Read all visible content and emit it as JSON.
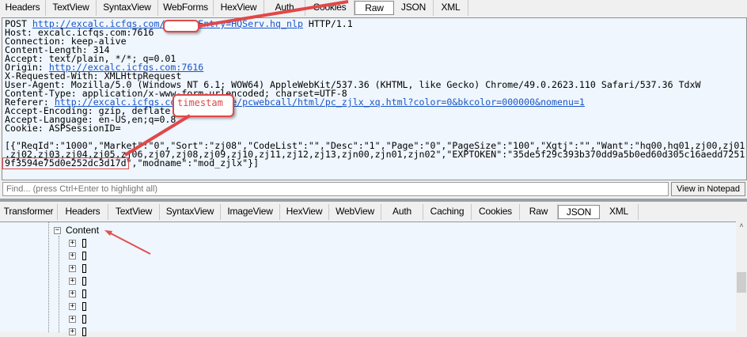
{
  "top_tabs": [
    "Headers",
    "TextView",
    "SyntaxView",
    "WebForms",
    "HexView",
    "Auth",
    "Cookies",
    "Raw",
    "JSON",
    "XML"
  ],
  "top_selected": "Raw",
  "raw": {
    "l0a": "POST ",
    "l0link": "http://excalc.icfqs.com",
    "l0hidden": "/TQLEX?Entry=HQServ.hq_nlp",
    "l0b": " HTTP/1.1",
    "lines": [
      "Host: excalc.icfqs.com:7616",
      "Connection: keep-alive",
      "Content-Length: 314",
      "Accept: text/plain, */*; q=0.01"
    ],
    "origin_label": "Origin: ",
    "origin_link": "http://excalc.icfqs.com:7616",
    "lines2": [
      "X-Requested-With: XMLHttpRequest",
      "User-Agent: Mozilla/5.0 (Windows NT 6.1; WOW64) AppleWebKit/537.36 (KHTML, like Gecko) Chrome/49.0.2623.110 Safari/537.36 TdxW",
      "Content-Type: application/x-www-form-urlencoded; charset=UTF-8"
    ],
    "referer_label": "Referer: ",
    "referer_link": "http://excalc.icfqs.com:7616/site/pcwebcall/html/pc_zjlx_xq.html?color=0&bkcolor=000000&nomenu=1",
    "lines3": [
      "Accept-Encoding: gzip, deflate",
      "Accept-Language: en-US,en;q=0.8",
      "Cookie: ASPSessionID="
    ],
    "body": [
      "[{\"ReqId\":\"1000\",\"Market\":\"0\",\"Sort\":\"zj08\",\"CodeList\":\"\",\"Desc\":\"1\",\"Page\":\"0\",\"PageSize\":\"100\",\"Xgtj\":\"\",\"Want\":\"hq00,hq01,zj00,zj01",
      ",zj02,zj03,zj04,zj05,zj06,zj07,zj08,zj09,zj10,zj11,zj12,zj13,zjn00,zjn01,zjn02\",\"EXPTOKEN\":\"35de5f29c393b370dd9a5b0ed60d305c16aedd7251",
      "9f3594e75d0e252dc3d17d\",\"modname\":\"mod_zjlx\"}]"
    ]
  },
  "find_placeholder": "Find... (press Ctrl+Enter to highlight all)",
  "view_in_notepad": "View in Notepad",
  "bottom_tabs": [
    "Transformer",
    "Headers",
    "TextView",
    "SyntaxView",
    "ImageView",
    "HexView",
    "WebView",
    "Auth",
    "Caching",
    "Cookies",
    "Raw",
    "JSON",
    "XML"
  ],
  "bottom_selected": "JSON",
  "tree": {
    "root": "Content",
    "collapse": "−",
    "expand": "+"
  },
  "annotations": {
    "timestamp": "timestam"
  },
  "colors": {
    "annotation": "#e04848",
    "link": "#1a55c8",
    "pane_bg": "#eff6fd"
  }
}
